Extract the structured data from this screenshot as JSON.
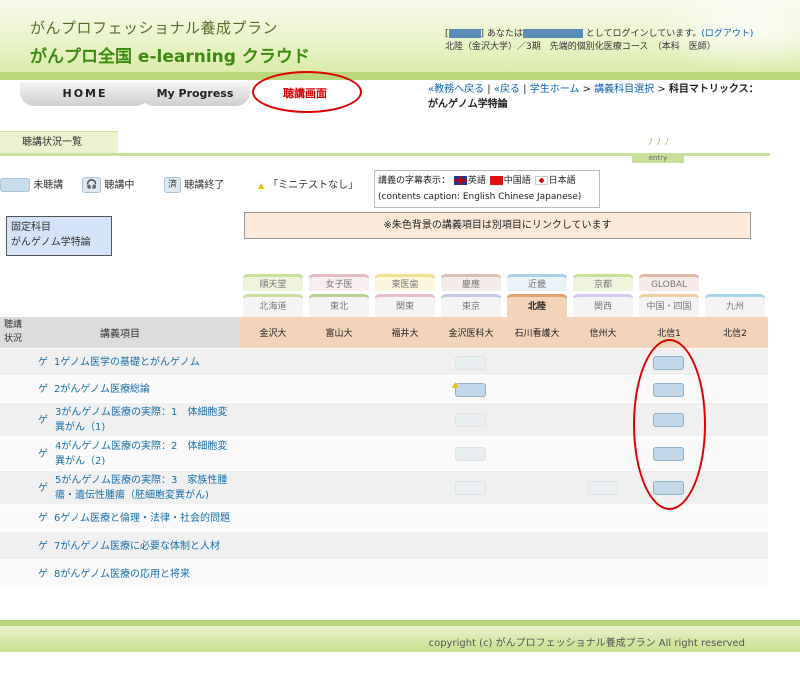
{
  "header": {
    "brand_line1": "がんプロフェッショナル養成プラン",
    "brand_line2": "がんプロ全国 e-learning クラウド",
    "user_prefix": "[",
    "user_mid": "] あなたは",
    "user_suffix": "としてログインしています。",
    "logout": "(ログアウト)",
    "course_info": "北陸（金沢大学）／3期　先端的個別化医療コース　（本科　医師）"
  },
  "nav": {
    "home": "HOME",
    "progress": "My Progress",
    "lecture": "聴講画面"
  },
  "breadcrumb": {
    "back_teacher": "«教務へ戻る",
    "sep1": " | ",
    "back": "«戻る",
    "sep2": " | ",
    "student_home": "学生ホーム",
    "arrow1": " > ",
    "subject_select": "講義科目選択",
    "arrow2": " > ",
    "current": "科目マトリックス：",
    "subject": "がんゲノム学特論"
  },
  "section_tab": "聴講状況一覧",
  "entry_label": "entry",
  "legend": {
    "unwatched": "未聴講",
    "watching": "聴講中",
    "watching_icon_text": "🎧",
    "done_icon_text": "済",
    "done": "聴講終了",
    "no_minitest": "「ミニテストなし」"
  },
  "caption": {
    "title": "講義の字幕表示：",
    "en": "英語",
    "cn": "中国語",
    "jp": "日本語",
    "subtitle": "(contents caption: English Chinese  Japanese)"
  },
  "fixed_subject": {
    "label": "固定科目",
    "name": "がんゲノム学特論"
  },
  "note": "※朱色背景の講義項目は別項目にリンクしています",
  "region_tabs_row1": [
    "順天堂",
    "女子医",
    "東医歯",
    "慶應",
    "近畿",
    "京都",
    "GLOBAL"
  ],
  "region_tabs_row2": [
    "北海道",
    "東北",
    "関東",
    "東京",
    "北陸",
    "関西",
    "中国・四国",
    "九州"
  ],
  "active_region": "北陸",
  "table_header": {
    "status": "聴講\n状況",
    "course": "講義項目"
  },
  "columns": [
    "金沢大",
    "富山大",
    "福井大",
    "金沢医科大",
    "石川看護大",
    "信州大",
    "北信1",
    "北信2"
  ],
  "rows": [
    {
      "prefix": "ゲ",
      "title1": "1ゲノム医学の基礎とがんゲノム",
      "title2": ""
    },
    {
      "prefix": "ゲ",
      "title1": "2がんゲノム医療総論",
      "title2": ""
    },
    {
      "prefix": "ゲ",
      "title1": "3がんゲノム医療の実際：1　体細胞変",
      "title2": "異がん（1)"
    },
    {
      "prefix": "ゲ",
      "title1": "4がんゲノム医療の実際：2　体細胞変",
      "title2": "異がん（2)"
    },
    {
      "prefix": "ゲ",
      "title1": "5がんゲノム医療の実際：3　家族性腫",
      "title2": "瘍・遺伝性腫瘍（胚細胞変異がん)"
    },
    {
      "prefix": "ゲ",
      "title1": "6ゲノム医療と倫理・法律・社会的問題",
      "title2": ""
    },
    {
      "prefix": "ゲ",
      "title1": "7がんゲノム医療に必要な体制と人材",
      "title2": ""
    },
    {
      "prefix": "ゲ",
      "title1": "8がんゲノム医療の応用と将来",
      "title2": ""
    }
  ],
  "footer": "copyright (c) がんプロフェッショナル養成プラン All right reserved",
  "colors": {
    "accent_green": "#3d8a12",
    "link_blue": "#1a6fa8",
    "highlight_red": "#e00000"
  }
}
